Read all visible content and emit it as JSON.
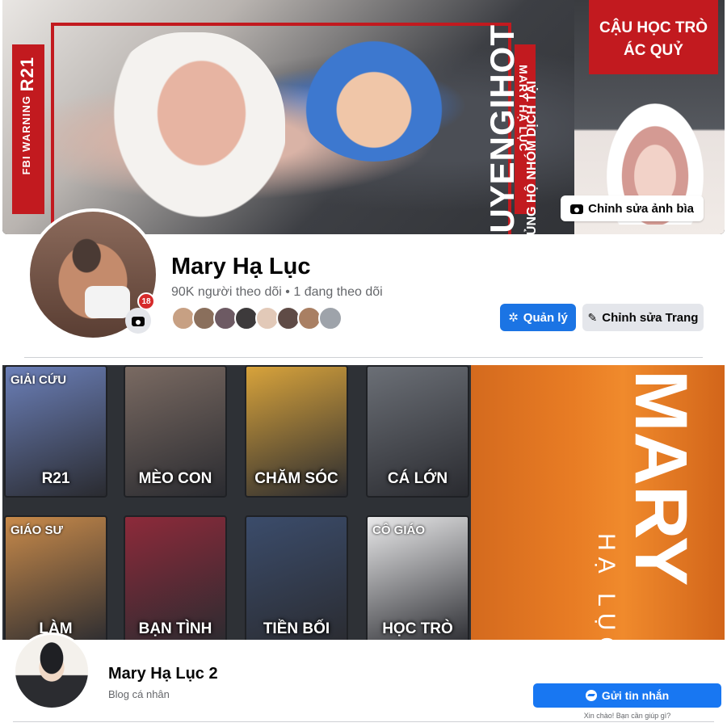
{
  "profile1": {
    "name": "Mary Hạ Lục",
    "stats": "90K người theo dõi • 1 đang theo dõi",
    "edit_cover_label": "Chỉnh sửa ảnh bìa",
    "manage_label": "Quản lý",
    "edit_page_label": "Chỉnh sửa Trang",
    "cover_texts": {
      "rating": "R21",
      "warning": "FBI WARNING",
      "side_title": "MARY HẠ LỤC",
      "box_line1": "CẬU HỌC TRÒ",
      "box_line2": "ÁC QUỶ"
    },
    "avatar_badge": "18",
    "follower_colors": [
      "#c7a083",
      "#8a6f5c",
      "#6d5a63",
      "#3d3a3b",
      "#e2c9b8",
      "#5f4b46",
      "#a97f63",
      "#9ea3aa"
    ],
    "colors": {
      "primary": "#1b74e4",
      "secondary_btn": "#e4e6eb",
      "cover_red": "#c21a1f"
    }
  },
  "profile2": {
    "name": "Mary Hạ Lục 2",
    "subtitle": "Blog cá nhân",
    "message_label": "Gửi tin nhắn",
    "greeting": "Xin chào! Bạn cần giúp gì?",
    "tiles": [
      {
        "top": "GIẢI CỨU",
        "label": "R21",
        "color": "#6b7fb8"
      },
      {
        "top": "",
        "label": "MÈO CON",
        "color": "#7a6a62"
      },
      {
        "top": "",
        "label": "CHĂM SÓC",
        "color": "#d8a33b"
      },
      {
        "top": "",
        "label": "CÁ LỚN",
        "color": "#6b6f76"
      },
      {
        "top": "GIÁO SƯ",
        "label": "LÀM",
        "color": "#c88a4a"
      },
      {
        "top": "",
        "label": "BẠN TÌNH",
        "color": "#8d2a3a"
      },
      {
        "top": "",
        "label": "TIỀN BỐI",
        "color": "#3b4c6b"
      },
      {
        "top": "CÔ GIÁO",
        "label": "HỌC TRÒ",
        "color": "#e9e9ea"
      }
    ],
    "promo": {
      "brand": "MARY",
      "sub_brand": "HẠ LỤC",
      "headline": "TRUYENGIHOT",
      "tagline": "ỦNG HỘ NHÓM DỊCH TẠI"
    },
    "colors": {
      "primary": "#1877f2",
      "promo": "#e87c24"
    }
  }
}
